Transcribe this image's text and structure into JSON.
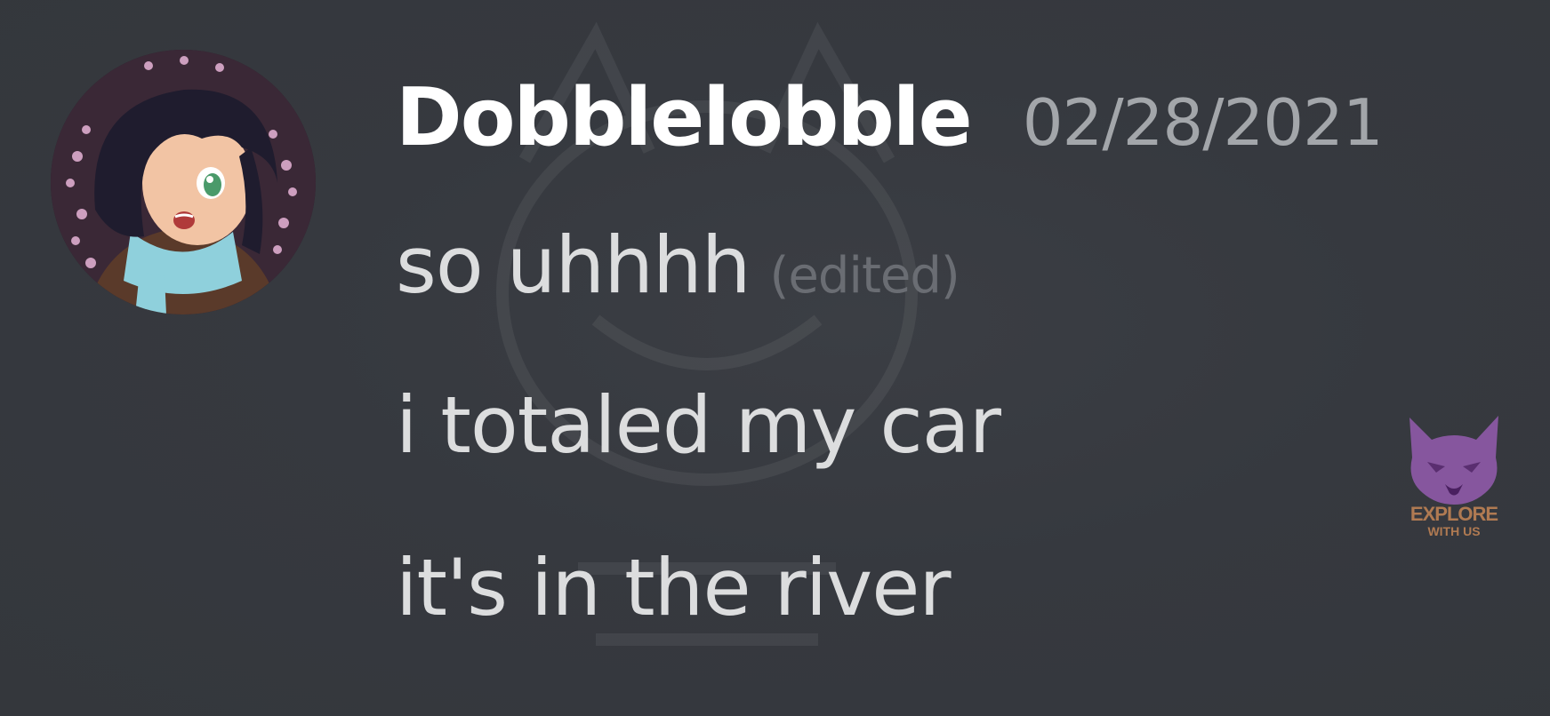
{
  "message": {
    "author": "Dobblelobble",
    "timestamp": "02/28/2021",
    "lines": [
      "so uhhhh",
      "i totaled my car",
      "it's in the river"
    ],
    "edited_label": "(edited)"
  },
  "avatar": {
    "icon": "anime-character-avatar"
  },
  "watermark": {
    "icon": "wolf-head-logo",
    "line1": "EXPLORE",
    "line2": "WITH US"
  },
  "colors": {
    "background": "#36393f",
    "username": "#ffffff",
    "timestamp": "#a3a6aa",
    "message_text": "#dcddde",
    "edited": "#6a6d73",
    "logo": "#8f5aa8"
  }
}
